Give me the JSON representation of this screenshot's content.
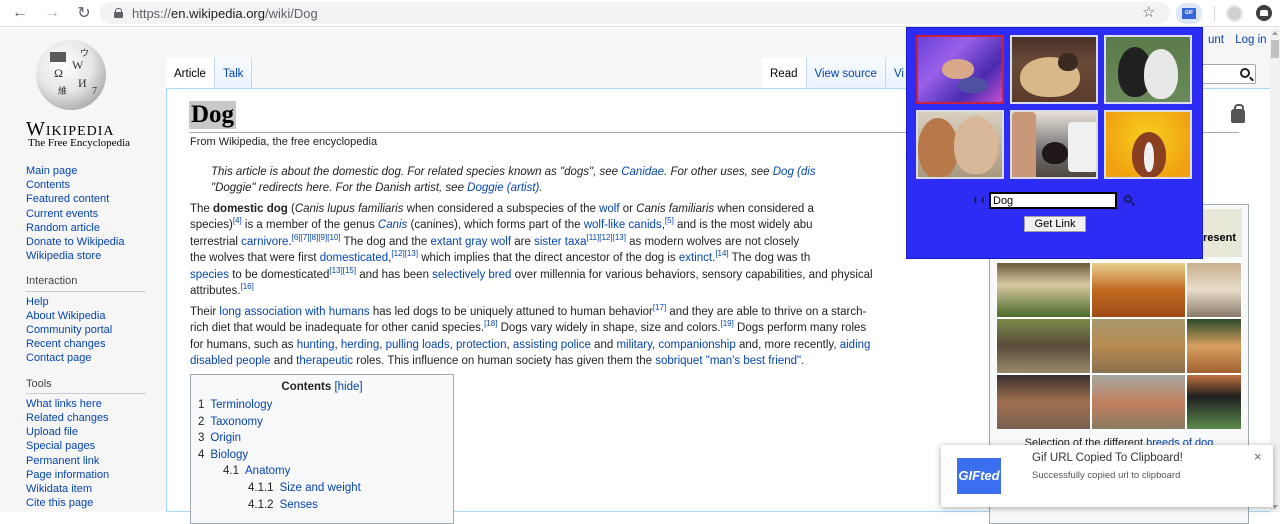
{
  "browser": {
    "url_scheme": "https://",
    "url_host": "en.wikipedia.org",
    "url_path": "/wiki/Dog",
    "icons": [
      "back-icon",
      "forward-icon",
      "reload-icon",
      "lock-icon",
      "star-icon",
      "gifted-extension-icon",
      "profile-icon",
      "menu-icon"
    ]
  },
  "logo": {
    "wordmark": "Wikipedia",
    "tagline": "The Free Encyclopedia",
    "glyphs": [
      "Ω",
      "W",
      "И",
      "維",
      "ウ",
      "7"
    ]
  },
  "sidebar": {
    "navigation": [
      "Main page",
      "Contents",
      "Featured content",
      "Current events",
      "Random article",
      "Donate to Wikipedia",
      "Wikipedia store"
    ],
    "interaction_heading": "Interaction",
    "interaction": [
      "Help",
      "About Wikipedia",
      "Community portal",
      "Recent changes",
      "Contact page"
    ],
    "tools_heading": "Tools",
    "tools": [
      "What links here",
      "Related changes",
      "Upload file",
      "Special pages",
      "Permanent link",
      "Page information",
      "Wikidata item",
      "Cite this page"
    ]
  },
  "tabs": {
    "left": [
      "Article",
      "Talk"
    ],
    "right": [
      "Read",
      "View source",
      "Vi"
    ]
  },
  "personal": {
    "account": "unt",
    "login": "Log in"
  },
  "article": {
    "title": "Dog",
    "subtitle": "From Wikipedia, the free encyclopedia",
    "hatnote": {
      "line1_a": "This article is about the domestic dog. For related species known as \"dogs\", see ",
      "line1_link1": "Canidae",
      "line1_b": ". For other uses, see ",
      "line1_link2": "Dog (dis",
      "line2_a": "\"Doggie\" redirects here. For the Danish artist, see ",
      "line2_link": "Doggie (artist)",
      "line2_b": "."
    },
    "p1": {
      "l1_a": "The ",
      "l1_bold": "domestic dog",
      "l1_b": " (",
      "l1_i1": "Canis lupus familiaris",
      "l1_c": " when considered a subspecies of the ",
      "l1_link": "wolf",
      "l1_d": " or ",
      "l1_i2": "Canis familiaris",
      "l1_e": " when considered a",
      "l2_a": "species)",
      "l2_sup1": "[4]",
      "l2_b": " is a member of the genus ",
      "l2_link1": "Canis",
      "l2_c": " (canines), which forms part of the ",
      "l2_link2": "wolf-like canids",
      "l2_d": ",",
      "l2_sup2": "[5]",
      "l2_e": " and is the most widely abu",
      "l3_a": "terrestrial ",
      "l3_link1": "carnivore",
      "l3_b": ".",
      "l3_sup1": "[6][7][8][9][10]",
      "l3_c": " The dog and the ",
      "l3_link2": "extant gray wolf",
      "l3_d": " are ",
      "l3_link3": "sister taxa",
      "l3_sup2": "[11][12][13]",
      "l3_e": " as modern wolves are not closely",
      "l4_a": "the wolves that were first ",
      "l4_link1": "domesticated",
      "l4_b": ",",
      "l4_sup1": "[12][13]",
      "l4_c": " which implies that the direct ancestor of the dog is ",
      "l4_link2": "extinct",
      "l4_d": ".",
      "l4_sup2": "[14]",
      "l4_e": " The dog was th",
      "l5_link1": "species",
      "l5_a": " to be domesticated",
      "l5_sup": "[13][15]",
      "l5_b": " and has been ",
      "l5_link2": "selectively bred",
      "l5_c": " over millennia for various behaviors, sensory capabilities, and physical",
      "l6_a": "attributes.",
      "l6_sup": "[16]"
    },
    "p2": {
      "l1_a": "Their ",
      "l1_link": "long association with humans",
      "l1_b": " has led dogs to be uniquely attuned to human behavior",
      "l1_sup": "[17]",
      "l1_c": " and they are able to thrive on a starch-",
      "l2_a": "rich diet that would be inadequate for other canid species.",
      "l2_sup1": "[18]",
      "l2_b": " Dogs vary widely in shape, size and colors.",
      "l2_sup2": "[19]",
      "l2_c": " Dogs perform many roles",
      "l3_a": "for humans, such as ",
      "l3_links": [
        "hunting",
        "herding",
        "pulling loads",
        "protection",
        "assisting police",
        "military",
        "companionship",
        "aiding"
      ],
      "l3_and1": " and ",
      "l3_and2": " and, more recently, ",
      "l4_link1": "disabled people",
      "l4_a": " and ",
      "l4_link2": "therapeutic",
      "l4_b": " roles. This influence on human society has given them the ",
      "l4_link3": "sobriquet",
      "l4_c": " ",
      "l4_link4": "\"man's best friend\"",
      "l4_d": "."
    },
    "toc": {
      "title": "Contents",
      "hide": "[hide]",
      "items": [
        {
          "num": "1",
          "label": "Terminology",
          "level": 1
        },
        {
          "num": "2",
          "label": "Taxonomy",
          "level": 1
        },
        {
          "num": "3",
          "label": "Origin",
          "level": 1
        },
        {
          "num": "4",
          "label": "Biology",
          "level": 1
        },
        {
          "num": "4.1",
          "label": "Anatomy",
          "level": 2
        },
        {
          "num": "4.1.1",
          "label": "Size and weight",
          "level": 3
        },
        {
          "num": "4.1.2",
          "label": "Senses",
          "level": 3
        }
      ]
    },
    "infobox": {
      "head_partial": "resent",
      "caption_a": "Selection of the different ",
      "caption_link": "breeds of dog"
    }
  },
  "gifted_popup": {
    "gifs": [
      {
        "desc": "french bulldog flying on purple background",
        "selected": true
      },
      {
        "desc": "pug lying down",
        "selected": false
      },
      {
        "desc": "black and white dogs hugging",
        "selected": false
      },
      {
        "desc": "two small dogs",
        "selected": false
      },
      {
        "desc": "small puppy being petted",
        "selected": false
      },
      {
        "desc": "boston terrier on yellow background",
        "selected": false
      }
    ],
    "search_value": "Dog",
    "get_link_label": "Get Link",
    "colors": {
      "background": "#2c2cf4",
      "selected_border": "#c82040"
    }
  },
  "toast": {
    "logo_text": "GIFted",
    "title": "Gif URL Copied To Clipboard!",
    "message": "Successfully copied url to clipboard",
    "close": "×"
  }
}
